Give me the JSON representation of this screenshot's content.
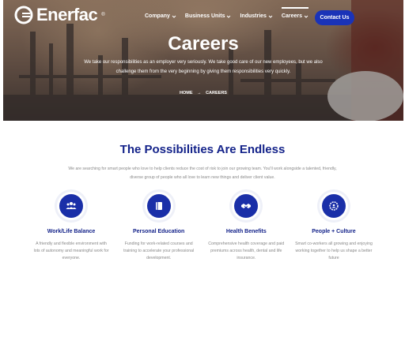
{
  "brand": {
    "name": "Enerfac",
    "reg": "®"
  },
  "nav": {
    "items": [
      {
        "label": "Company"
      },
      {
        "label": "Business Units"
      },
      {
        "label": "Industries"
      },
      {
        "label": "Careers"
      }
    ],
    "contact_label": "Contact Us"
  },
  "hero": {
    "title": "Careers",
    "text": "We take our responsibilities as an employer very seriously. We take good care of our new employees, but we also challenge them from the very beginning by giving them responsibilities very quickly.",
    "breadcrumb": {
      "home": "HOME",
      "separator": "→",
      "current": "CAREERS"
    }
  },
  "section": {
    "title": "The Possibilities Are Endless",
    "intro": "We are searching for smart people who love to help clients reduce the cost of risk to join our growing team. You'll work alongside a talented, friendly, diverse group of people who all love to learn new things and deliver client value."
  },
  "features": [
    {
      "icon": "people-icon",
      "title": "Work/Life Balance",
      "text": "A friendly and flexible environment with lots of autonomy and meaningful work for everyone."
    },
    {
      "icon": "book-icon",
      "title": "Personal Education",
      "text": "Funding for work-related courses and training to accelerate your professional development."
    },
    {
      "icon": "handshake-icon",
      "title": "Health Benefits",
      "text": "Comprehensive health coverage and paid premiums across health, dental and life insurance."
    },
    {
      "icon": "gear-people-icon",
      "title": "People + Culture",
      "text": "Smart co-workers all growing and enjoying working together to help us shape a better future"
    }
  ],
  "colors": {
    "brand_blue": "#14238a",
    "button_blue": "#1a33b8",
    "icon_blue": "#1a2fa8"
  }
}
